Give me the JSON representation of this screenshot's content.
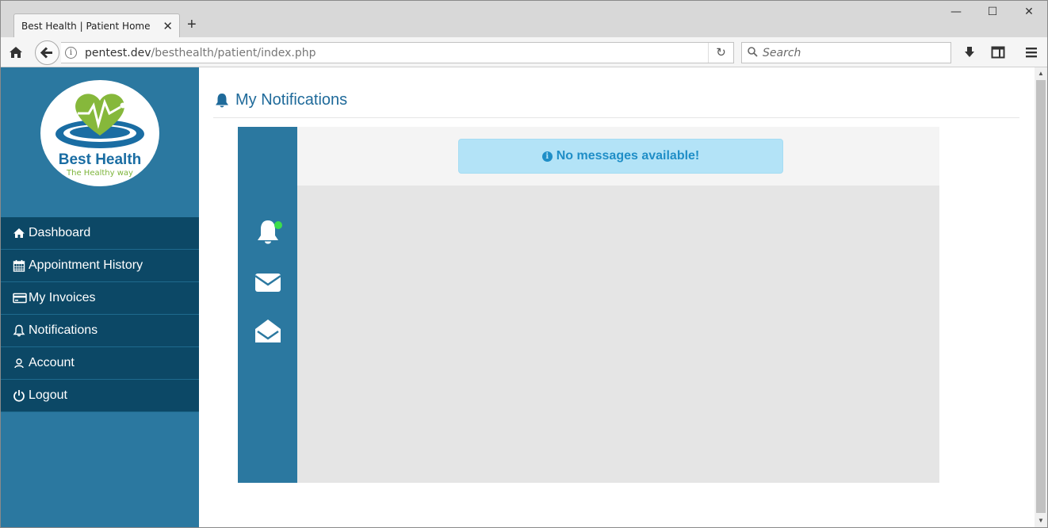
{
  "browser": {
    "tab_title": "Best Health | Patient Home",
    "tab_close": "✕",
    "new_tab": "+",
    "url_host": "pentest.dev",
    "url_path": "/besthealth/patient/index.php",
    "search_placeholder": "Search",
    "window_minimize": "—",
    "window_maximize": "☐",
    "window_close": "✕"
  },
  "sidebar": {
    "logo_title": "Best Health",
    "logo_subtitle": "The Healthy way",
    "items": [
      {
        "label": "Dashboard",
        "icon": "home-icon"
      },
      {
        "label": "Appointment History",
        "icon": "calendar-icon"
      },
      {
        "label": "My Invoices",
        "icon": "credit-card-icon"
      },
      {
        "label": "Notifications",
        "icon": "bell-icon"
      },
      {
        "label": "Account",
        "icon": "user-icon"
      },
      {
        "label": "Logout",
        "icon": "power-icon"
      }
    ]
  },
  "main": {
    "title": "My Notifications",
    "alert": "No messages available!"
  },
  "colors": {
    "sidebar": "#2b78a0",
    "menu": "#0c4866",
    "title": "#1f6a9a",
    "alert_bg": "#b3e3f7",
    "alert_text": "#1f8ec7",
    "status_dot": "#3dde4b"
  }
}
